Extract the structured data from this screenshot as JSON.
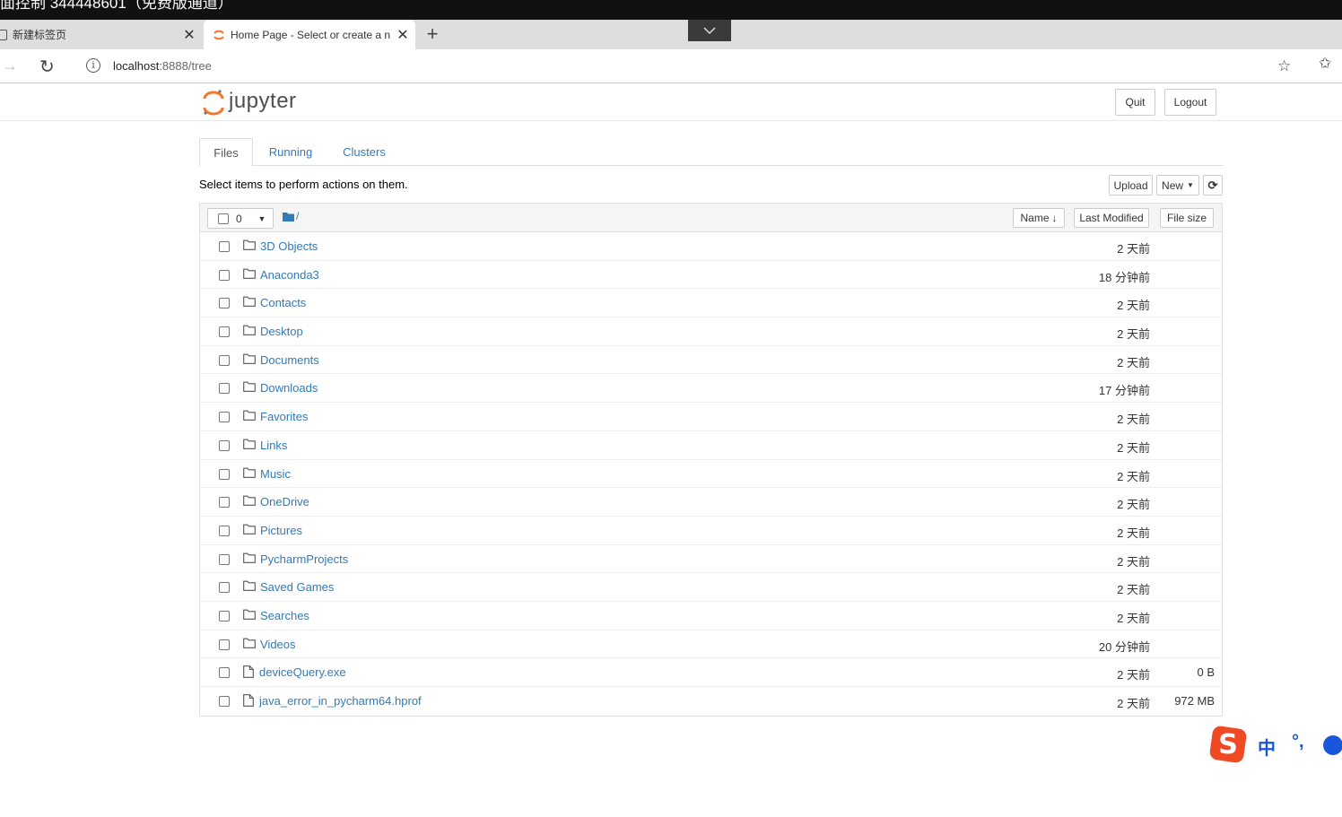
{
  "window": {
    "title": "面控制 344448601（免费版通道）"
  },
  "browser": {
    "tabs": [
      {
        "title": "新建标签页",
        "active": false
      },
      {
        "title": "Home Page - Select or create a n",
        "active": true
      }
    ],
    "new_tab": "+",
    "address": {
      "host": "localhost",
      "rest": ":8888/tree"
    }
  },
  "header": {
    "logo_text": "jupyter",
    "quit_label": "Quit",
    "logout_label": "Logout"
  },
  "tabs": [
    {
      "label": "Files",
      "active": true
    },
    {
      "label": "Running",
      "active": false
    },
    {
      "label": "Clusters",
      "active": false
    }
  ],
  "toolbar": {
    "select_info": "Select items to perform actions on them.",
    "upload_label": "Upload",
    "new_label": "New"
  },
  "list_header": {
    "selected_count": "0",
    "path": "/",
    "sort_name": "Name",
    "sort_modified": "Last Modified",
    "sort_size": "File size"
  },
  "files": [
    {
      "name": "3D Objects",
      "type": "folder",
      "modified": "2 天前",
      "size": ""
    },
    {
      "name": "Anaconda3",
      "type": "folder",
      "modified": "18 分钟前",
      "size": ""
    },
    {
      "name": "Contacts",
      "type": "folder",
      "modified": "2 天前",
      "size": ""
    },
    {
      "name": "Desktop",
      "type": "folder",
      "modified": "2 天前",
      "size": ""
    },
    {
      "name": "Documents",
      "type": "folder",
      "modified": "2 天前",
      "size": ""
    },
    {
      "name": "Downloads",
      "type": "folder",
      "modified": "17 分钟前",
      "size": ""
    },
    {
      "name": "Favorites",
      "type": "folder",
      "modified": "2 天前",
      "size": ""
    },
    {
      "name": "Links",
      "type": "folder",
      "modified": "2 天前",
      "size": ""
    },
    {
      "name": "Music",
      "type": "folder",
      "modified": "2 天前",
      "size": ""
    },
    {
      "name": "OneDrive",
      "type": "folder",
      "modified": "2 天前",
      "size": ""
    },
    {
      "name": "Pictures",
      "type": "folder",
      "modified": "2 天前",
      "size": ""
    },
    {
      "name": "PycharmProjects",
      "type": "folder",
      "modified": "2 天前",
      "size": ""
    },
    {
      "name": "Saved Games",
      "type": "folder",
      "modified": "2 天前",
      "size": ""
    },
    {
      "name": "Searches",
      "type": "folder",
      "modified": "2 天前",
      "size": ""
    },
    {
      "name": "Videos",
      "type": "folder",
      "modified": "20 分钟前",
      "size": ""
    },
    {
      "name": "deviceQuery.exe",
      "type": "file",
      "modified": "2 天前",
      "size": "0 B"
    },
    {
      "name": "java_error_in_pycharm64.hprof",
      "type": "file",
      "modified": "2 天前",
      "size": "972 MB"
    }
  ],
  "ime": {
    "mode": "中",
    "punct": "°,"
  },
  "colors": {
    "link": "#337ab7",
    "jupyter_orange": "#f37726",
    "ime_blue": "#1a56db"
  },
  "icons": [
    "folder-icon",
    "file-icon",
    "refresh-icon",
    "sort-down-icon",
    "caret-down-icon"
  ]
}
